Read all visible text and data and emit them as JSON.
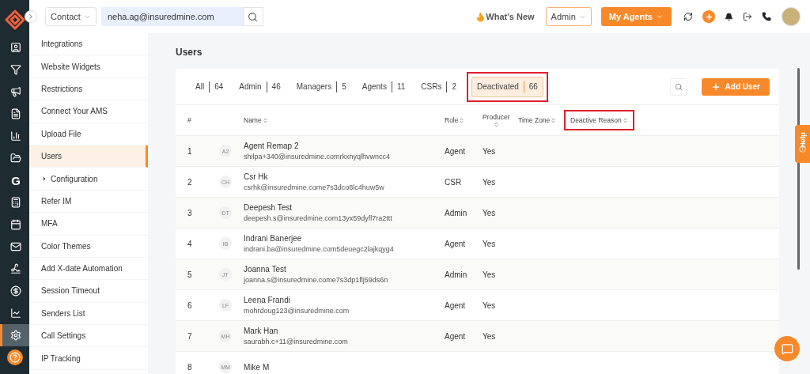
{
  "rail": {
    "items": [
      {
        "kind": "icon",
        "selected": false
      },
      {
        "kind": "icon",
        "selected": false
      },
      {
        "kind": "icon",
        "selected": false
      },
      {
        "kind": "icon",
        "selected": false
      },
      {
        "kind": "icon",
        "selected": false
      },
      {
        "kind": "icon",
        "selected": false
      },
      {
        "kind": "letter",
        "label": "G",
        "selected": false
      },
      {
        "kind": "icon",
        "selected": false
      },
      {
        "kind": "icon",
        "selected": false
      },
      {
        "kind": "icon",
        "selected": false
      },
      {
        "kind": "icon",
        "selected": false
      },
      {
        "kind": "icon",
        "selected": false
      },
      {
        "kind": "icon",
        "selected": false
      },
      {
        "kind": "icon",
        "selected": true
      }
    ]
  },
  "topbar": {
    "search_type": "Contact",
    "search_value": "neha.ag@insuredmine.com",
    "whats_new": "What's New",
    "role_select": "Admin",
    "agents_button": "My Agents"
  },
  "settings_menu": [
    {
      "label": "Integrations",
      "selected": false
    },
    {
      "label": "Website Widgets",
      "selected": false
    },
    {
      "label": "Restrictions",
      "selected": false
    },
    {
      "label": "Connect Your AMS",
      "selected": false
    },
    {
      "label": "Upload File",
      "selected": false
    },
    {
      "label": "Users",
      "selected": true
    },
    {
      "label": "Configuration",
      "selected": false,
      "expanded": false
    },
    {
      "label": "Refer IM",
      "selected": false
    },
    {
      "label": "MFA",
      "selected": false
    },
    {
      "label": "Color Themes",
      "selected": false
    },
    {
      "label": "Add X-date Automation",
      "selected": false
    },
    {
      "label": "Session Timeout",
      "selected": false
    },
    {
      "label": "Senders List",
      "selected": false
    },
    {
      "label": "Call Settings",
      "selected": false
    },
    {
      "label": "IP Tracking",
      "selected": false
    }
  ],
  "page_title": "Users",
  "tabs": [
    {
      "label": "All",
      "count": "64",
      "selected": false,
      "annotated": false
    },
    {
      "label": "Admin",
      "count": "46",
      "selected": false,
      "annotated": false
    },
    {
      "label": "Managers",
      "count": "5",
      "selected": false,
      "annotated": false
    },
    {
      "label": "Agents",
      "count": "11",
      "selected": false,
      "annotated": false
    },
    {
      "label": "CSRs",
      "count": "2",
      "selected": false,
      "annotated": false
    },
    {
      "label": "Deactivated",
      "count": "66",
      "selected": true,
      "annotated": true
    }
  ],
  "add_button": "Add User",
  "table": {
    "columns": [
      {
        "label": "#",
        "sortable": false,
        "annotated": false
      },
      {
        "label": "Name",
        "sortable": true,
        "annotated": false
      },
      {
        "label": "Role",
        "sortable": true,
        "annotated": false
      },
      {
        "label": "Producer",
        "sortable": true,
        "annotated": false
      },
      {
        "label": "Time Zone",
        "sortable": true,
        "annotated": false
      },
      {
        "label": "Deactive Reason",
        "sortable": true,
        "annotated": true
      }
    ],
    "rows": [
      {
        "index": "1",
        "initials": "A2",
        "name": "Agent Remap 2",
        "email": "shilpa+340@insuredmine.comrkxnyqlhvwncc4",
        "role": "Agent",
        "producer": "Yes"
      },
      {
        "index": "2",
        "initials": "CH",
        "name": "Csr Hk",
        "email": "csrhk@insuredmine.come7s3dco8lc4huw5w",
        "role": "CSR",
        "producer": "Yes"
      },
      {
        "index": "3",
        "initials": "DT",
        "name": "Deepesh Test",
        "email": "deepesh.s@insuredmine.com13yx59dyfl7ra2ttt",
        "role": "Admin",
        "producer": "Yes"
      },
      {
        "index": "4",
        "initials": "IB",
        "name": "Indrani Banerjee",
        "email": "indrani.ba@insuredmine.com5deuegc2lajkqyg4",
        "role": "Agent",
        "producer": "Yes"
      },
      {
        "index": "5",
        "initials": "JT",
        "name": "Joanna Test",
        "email": "joanna.s@insuredmine.come7s3dp1flj59ds6n",
        "role": "Admin",
        "producer": "Yes"
      },
      {
        "index": "6",
        "initials": "LF",
        "name": "Leena Frandi",
        "email": "mohrdoug123@insuredmine.com",
        "role": "Agent",
        "producer": "Yes"
      },
      {
        "index": "7",
        "initials": "MH",
        "name": "Mark Han",
        "email": "saurabh.c+11@insuredmine.com",
        "role": "Agent",
        "producer": "Yes"
      },
      {
        "index": "8",
        "initials": "MM",
        "name": "Mike M"
      }
    ]
  },
  "help_tab": "Help"
}
